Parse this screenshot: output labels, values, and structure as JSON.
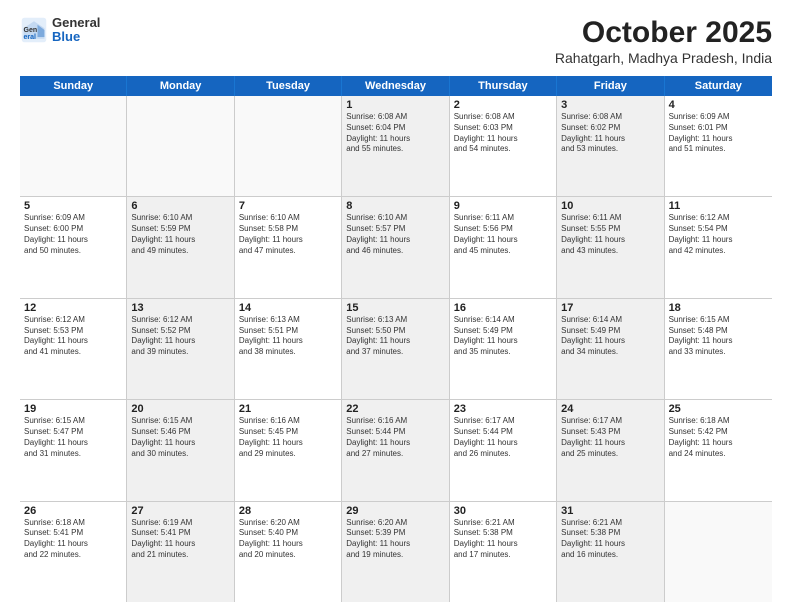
{
  "header": {
    "logo_general": "General",
    "logo_blue": "Blue",
    "title": "October 2025",
    "subtitle": "Rahatgarh, Madhya Pradesh, India"
  },
  "days_of_week": [
    "Sunday",
    "Monday",
    "Tuesday",
    "Wednesday",
    "Thursday",
    "Friday",
    "Saturday"
  ],
  "weeks": [
    [
      {
        "day": "",
        "info": "",
        "shaded": false,
        "empty": true
      },
      {
        "day": "",
        "info": "",
        "shaded": false,
        "empty": true
      },
      {
        "day": "",
        "info": "",
        "shaded": false,
        "empty": true
      },
      {
        "day": "1",
        "info": "Sunrise: 6:08 AM\nSunset: 6:04 PM\nDaylight: 11 hours\nand 55 minutes.",
        "shaded": true,
        "empty": false
      },
      {
        "day": "2",
        "info": "Sunrise: 6:08 AM\nSunset: 6:03 PM\nDaylight: 11 hours\nand 54 minutes.",
        "shaded": false,
        "empty": false
      },
      {
        "day": "3",
        "info": "Sunrise: 6:08 AM\nSunset: 6:02 PM\nDaylight: 11 hours\nand 53 minutes.",
        "shaded": true,
        "empty": false
      },
      {
        "day": "4",
        "info": "Sunrise: 6:09 AM\nSunset: 6:01 PM\nDaylight: 11 hours\nand 51 minutes.",
        "shaded": false,
        "empty": false
      }
    ],
    [
      {
        "day": "5",
        "info": "Sunrise: 6:09 AM\nSunset: 6:00 PM\nDaylight: 11 hours\nand 50 minutes.",
        "shaded": false,
        "empty": false
      },
      {
        "day": "6",
        "info": "Sunrise: 6:10 AM\nSunset: 5:59 PM\nDaylight: 11 hours\nand 49 minutes.",
        "shaded": true,
        "empty": false
      },
      {
        "day": "7",
        "info": "Sunrise: 6:10 AM\nSunset: 5:58 PM\nDaylight: 11 hours\nand 47 minutes.",
        "shaded": false,
        "empty": false
      },
      {
        "day": "8",
        "info": "Sunrise: 6:10 AM\nSunset: 5:57 PM\nDaylight: 11 hours\nand 46 minutes.",
        "shaded": true,
        "empty": false
      },
      {
        "day": "9",
        "info": "Sunrise: 6:11 AM\nSunset: 5:56 PM\nDaylight: 11 hours\nand 45 minutes.",
        "shaded": false,
        "empty": false
      },
      {
        "day": "10",
        "info": "Sunrise: 6:11 AM\nSunset: 5:55 PM\nDaylight: 11 hours\nand 43 minutes.",
        "shaded": true,
        "empty": false
      },
      {
        "day": "11",
        "info": "Sunrise: 6:12 AM\nSunset: 5:54 PM\nDaylight: 11 hours\nand 42 minutes.",
        "shaded": false,
        "empty": false
      }
    ],
    [
      {
        "day": "12",
        "info": "Sunrise: 6:12 AM\nSunset: 5:53 PM\nDaylight: 11 hours\nand 41 minutes.",
        "shaded": false,
        "empty": false
      },
      {
        "day": "13",
        "info": "Sunrise: 6:12 AM\nSunset: 5:52 PM\nDaylight: 11 hours\nand 39 minutes.",
        "shaded": true,
        "empty": false
      },
      {
        "day": "14",
        "info": "Sunrise: 6:13 AM\nSunset: 5:51 PM\nDaylight: 11 hours\nand 38 minutes.",
        "shaded": false,
        "empty": false
      },
      {
        "day": "15",
        "info": "Sunrise: 6:13 AM\nSunset: 5:50 PM\nDaylight: 11 hours\nand 37 minutes.",
        "shaded": true,
        "empty": false
      },
      {
        "day": "16",
        "info": "Sunrise: 6:14 AM\nSunset: 5:49 PM\nDaylight: 11 hours\nand 35 minutes.",
        "shaded": false,
        "empty": false
      },
      {
        "day": "17",
        "info": "Sunrise: 6:14 AM\nSunset: 5:49 PM\nDaylight: 11 hours\nand 34 minutes.",
        "shaded": true,
        "empty": false
      },
      {
        "day": "18",
        "info": "Sunrise: 6:15 AM\nSunset: 5:48 PM\nDaylight: 11 hours\nand 33 minutes.",
        "shaded": false,
        "empty": false
      }
    ],
    [
      {
        "day": "19",
        "info": "Sunrise: 6:15 AM\nSunset: 5:47 PM\nDaylight: 11 hours\nand 31 minutes.",
        "shaded": false,
        "empty": false
      },
      {
        "day": "20",
        "info": "Sunrise: 6:15 AM\nSunset: 5:46 PM\nDaylight: 11 hours\nand 30 minutes.",
        "shaded": true,
        "empty": false
      },
      {
        "day": "21",
        "info": "Sunrise: 6:16 AM\nSunset: 5:45 PM\nDaylight: 11 hours\nand 29 minutes.",
        "shaded": false,
        "empty": false
      },
      {
        "day": "22",
        "info": "Sunrise: 6:16 AM\nSunset: 5:44 PM\nDaylight: 11 hours\nand 27 minutes.",
        "shaded": true,
        "empty": false
      },
      {
        "day": "23",
        "info": "Sunrise: 6:17 AM\nSunset: 5:44 PM\nDaylight: 11 hours\nand 26 minutes.",
        "shaded": false,
        "empty": false
      },
      {
        "day": "24",
        "info": "Sunrise: 6:17 AM\nSunset: 5:43 PM\nDaylight: 11 hours\nand 25 minutes.",
        "shaded": true,
        "empty": false
      },
      {
        "day": "25",
        "info": "Sunrise: 6:18 AM\nSunset: 5:42 PM\nDaylight: 11 hours\nand 24 minutes.",
        "shaded": false,
        "empty": false
      }
    ],
    [
      {
        "day": "26",
        "info": "Sunrise: 6:18 AM\nSunset: 5:41 PM\nDaylight: 11 hours\nand 22 minutes.",
        "shaded": false,
        "empty": false
      },
      {
        "day": "27",
        "info": "Sunrise: 6:19 AM\nSunset: 5:41 PM\nDaylight: 11 hours\nand 21 minutes.",
        "shaded": true,
        "empty": false
      },
      {
        "day": "28",
        "info": "Sunrise: 6:20 AM\nSunset: 5:40 PM\nDaylight: 11 hours\nand 20 minutes.",
        "shaded": false,
        "empty": false
      },
      {
        "day": "29",
        "info": "Sunrise: 6:20 AM\nSunset: 5:39 PM\nDaylight: 11 hours\nand 19 minutes.",
        "shaded": true,
        "empty": false
      },
      {
        "day": "30",
        "info": "Sunrise: 6:21 AM\nSunset: 5:38 PM\nDaylight: 11 hours\nand 17 minutes.",
        "shaded": false,
        "empty": false
      },
      {
        "day": "31",
        "info": "Sunrise: 6:21 AM\nSunset: 5:38 PM\nDaylight: 11 hours\nand 16 minutes.",
        "shaded": true,
        "empty": false
      },
      {
        "day": "",
        "info": "",
        "shaded": false,
        "empty": true
      }
    ]
  ]
}
